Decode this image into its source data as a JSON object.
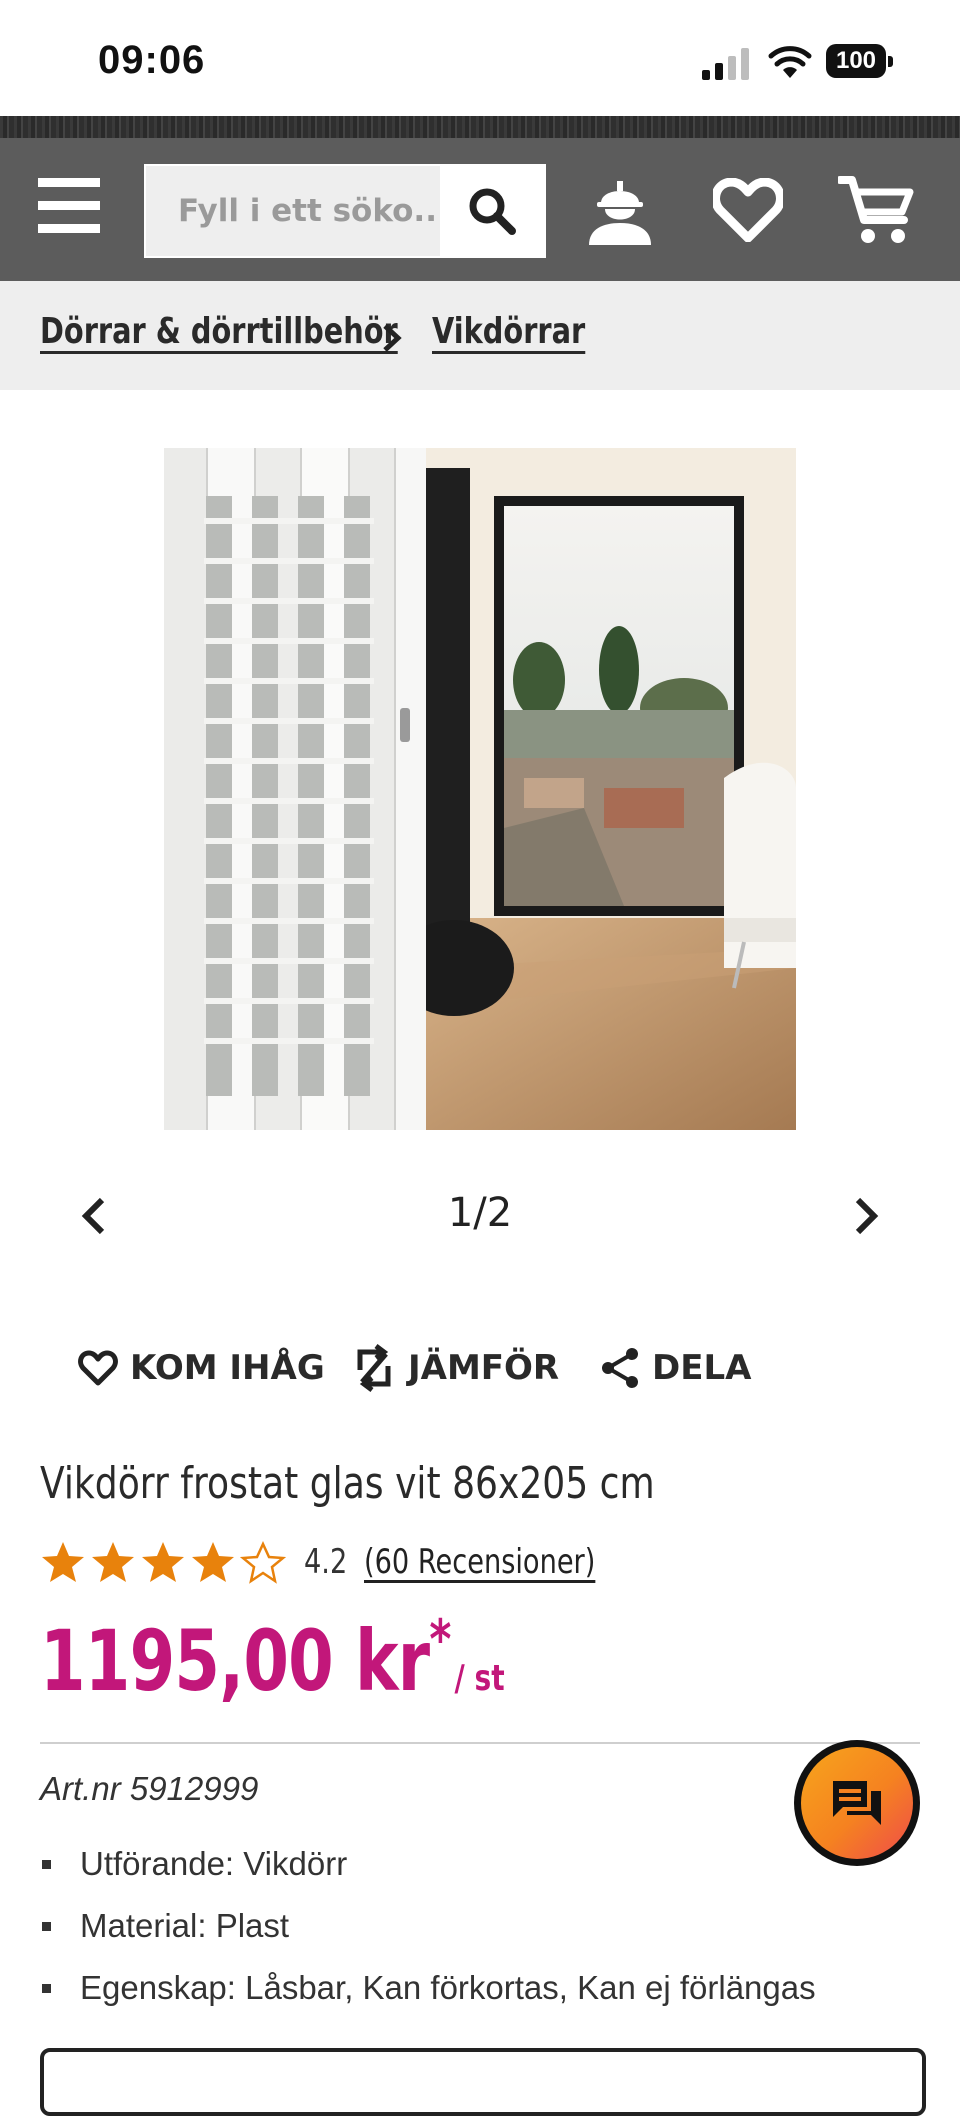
{
  "status_bar": {
    "time": "09:06",
    "battery": "100"
  },
  "header": {
    "search_placeholder": "Fyll i ett söko...",
    "icons": [
      "menu-icon",
      "search-icon",
      "account-icon",
      "heart-icon",
      "cart-icon"
    ]
  },
  "breadcrumb": {
    "items": [
      {
        "label": "Dörrar & dörrtillbehör"
      },
      {
        "label": "Vikdörrar"
      }
    ]
  },
  "carousel": {
    "counter": "1/2"
  },
  "actions": {
    "remember": "KOM IHÅG",
    "compare": "JÄMFÖR",
    "share": "DELA"
  },
  "product": {
    "title": "Vikdörr frostat glas vit 86x205 cm",
    "rating": 4.2,
    "rating_text": "4.2",
    "reviews": "(60 Recensioner)",
    "price": "1195,00 kr",
    "price_mark": "*",
    "unit": "/ st",
    "art_nr": "Art.nr 5912999",
    "specs": [
      "Utförande: Vikdörr",
      "Material: Plast",
      "Egenskap: Låsbar, Kan förkortas, Kan ej förlängas"
    ]
  },
  "colors": {
    "header_bg": "#5c5c5c",
    "price": "#c2177a",
    "star": "#e8820c",
    "chat_gradient_start": "#f7a51c",
    "chat_gradient_end": "#ef4b4b"
  }
}
